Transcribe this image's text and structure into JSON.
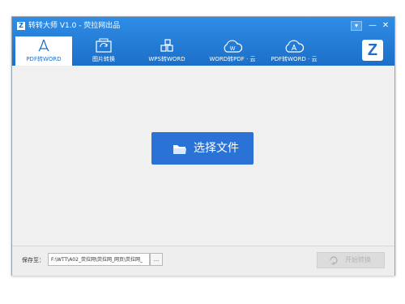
{
  "window": {
    "title": "转转大师 V1.0 - 荧拉网出品",
    "logo_letter": "Z",
    "menu_glyph": "▾",
    "minimize_glyph": "—",
    "close_glyph": "✕",
    "brand_letter": "Z"
  },
  "tabs": [
    {
      "label": "PDF转WORD",
      "icon": "pdf-icon",
      "active": true
    },
    {
      "label": "图片转换",
      "icon": "image-convert-icon",
      "active": false
    },
    {
      "label": "WPS转WORD",
      "icon": "wps-icon",
      "active": false
    },
    {
      "label": "WORD转PDF · 云",
      "icon": "word-cloud-icon",
      "active": false
    },
    {
      "label": "PDF转WORD · 云",
      "icon": "pdf-cloud-icon",
      "active": false
    }
  ],
  "main": {
    "select_button_label": "选择文件",
    "select_button_icon": "folder-icon"
  },
  "footer": {
    "save_label": "保存至：",
    "path_value": "F:\\WTT\\A02_荧拉网\\荧拉网_网页\\荧拉网_",
    "browse_label": "...",
    "start_label": "开始转换",
    "start_icon": "refresh-icon"
  },
  "colors": {
    "titlebar": "#1c6fc8",
    "accent_button": "#2a72d6",
    "disabled_button": "#dcdcdc"
  }
}
